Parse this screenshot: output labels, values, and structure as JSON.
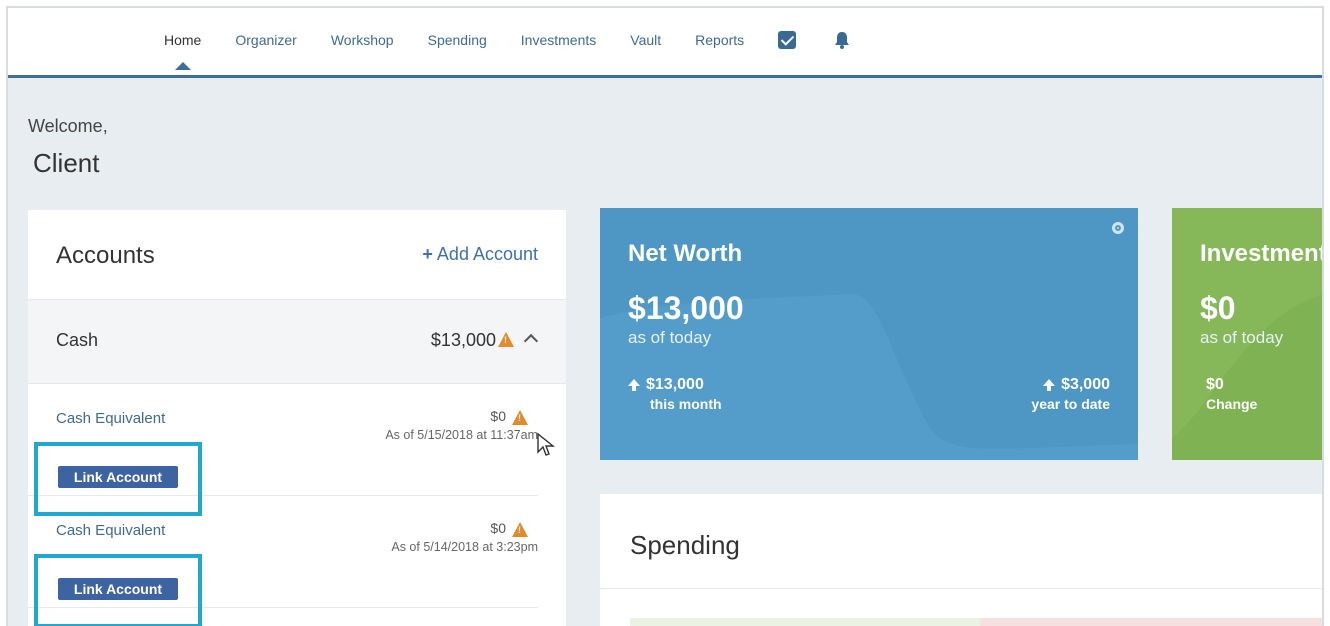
{
  "nav": {
    "items": [
      "Home",
      "Organizer",
      "Workshop",
      "Spending",
      "Investments",
      "Vault",
      "Reports"
    ],
    "active": "Home",
    "icons": [
      "checkbox-icon",
      "bell-icon"
    ]
  },
  "welcome": {
    "greeting": "Welcome,",
    "name": "Client"
  },
  "accounts": {
    "title": "Accounts",
    "add_label": "Add Account",
    "group": {
      "label": "Cash",
      "amount": "$13,000"
    },
    "rows": [
      {
        "name": "Cash Equivalent",
        "amount": "$0",
        "date": "As of 5/15/2018 at 11:37am",
        "button": "Link Account"
      },
      {
        "name": "Cash Equivalent",
        "amount": "$0",
        "date": "As of 5/14/2018 at 3:23pm",
        "button": "Link Account"
      }
    ]
  },
  "networth": {
    "title": "Net Worth",
    "value": "$13,000",
    "sub": "as of today",
    "month_value": "$13,000",
    "month_label": "this month",
    "ytd_value": "$3,000",
    "ytd_label": "year to date"
  },
  "investments": {
    "title": "Investment",
    "value": "$0",
    "sub": "as of today",
    "change_value": "$0",
    "change_label": "Change"
  },
  "spending": {
    "title": "Spending"
  },
  "colors": {
    "accent": "#3e6e9a",
    "networth": "#4e97c4",
    "investments": "#86b85a",
    "warning": "#e58a2a",
    "highlight": "#21a8d1",
    "link_button": "#3d63a0"
  }
}
